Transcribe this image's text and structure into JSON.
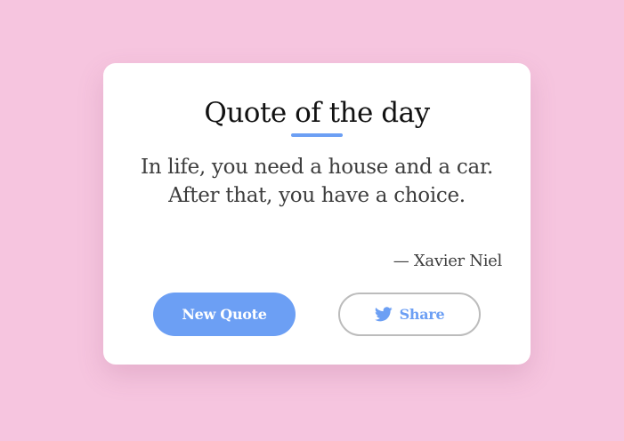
{
  "card": {
    "title": "Quote of the day",
    "quote_lines": [
      "In life, you need a house and a car.",
      "After that, you have a choice."
    ],
    "author": "— Xavier Niel"
  },
  "actions": {
    "new_quote_label": "New Quote",
    "share_label": "Share",
    "share_icon": "twitter-icon"
  },
  "colors": {
    "background": "#f6c5df",
    "accent": "#6c9ff4",
    "card": "#ffffff",
    "text": "#3d3d3d"
  }
}
